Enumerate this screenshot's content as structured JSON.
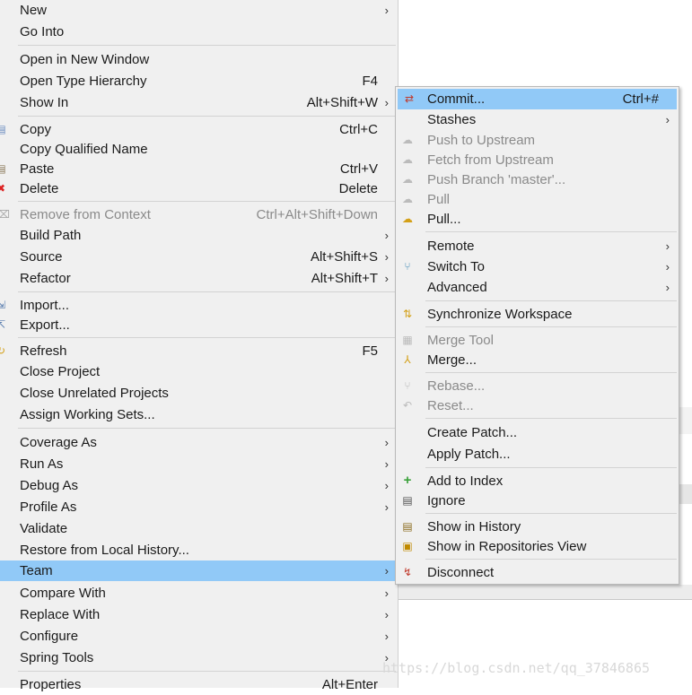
{
  "main_menu": {
    "items": [
      {
        "label": "New",
        "accel": "",
        "submenu": true
      },
      {
        "label": "Go Into",
        "accel": "",
        "submenu": false
      },
      {
        "label": "Open in New Window",
        "accel": "",
        "submenu": false
      },
      {
        "label": "Open Type Hierarchy",
        "accel": "F4",
        "submenu": false
      },
      {
        "label": "Show In",
        "accel": "Alt+Shift+W",
        "submenu": true
      },
      {
        "label": "Copy",
        "accel": "Ctrl+C",
        "submenu": false
      },
      {
        "label": "Copy Qualified Name",
        "accel": "",
        "submenu": false
      },
      {
        "label": "Paste",
        "accel": "Ctrl+V",
        "submenu": false
      },
      {
        "label": "Delete",
        "accel": "Delete",
        "submenu": false
      },
      {
        "label": "Remove from Context",
        "accel": "Ctrl+Alt+Shift+Down",
        "submenu": false,
        "disabled": true
      },
      {
        "label": "Build Path",
        "accel": "",
        "submenu": true
      },
      {
        "label": "Source",
        "accel": "Alt+Shift+S",
        "submenu": true
      },
      {
        "label": "Refactor",
        "accel": "Alt+Shift+T",
        "submenu": true
      },
      {
        "label": "Import...",
        "accel": "",
        "submenu": false
      },
      {
        "label": "Export...",
        "accel": "",
        "submenu": false
      },
      {
        "label": "Refresh",
        "accel": "F5",
        "submenu": false
      },
      {
        "label": "Close Project",
        "accel": "",
        "submenu": false
      },
      {
        "label": "Close Unrelated Projects",
        "accel": "",
        "submenu": false
      },
      {
        "label": "Assign Working Sets...",
        "accel": "",
        "submenu": false
      },
      {
        "label": "Coverage As",
        "accel": "",
        "submenu": true
      },
      {
        "label": "Run As",
        "accel": "",
        "submenu": true
      },
      {
        "label": "Debug As",
        "accel": "",
        "submenu": true
      },
      {
        "label": "Profile As",
        "accel": "",
        "submenu": true
      },
      {
        "label": "Validate",
        "accel": "",
        "submenu": false
      },
      {
        "label": "Restore from Local History...",
        "accel": "",
        "submenu": false
      },
      {
        "label": "Team",
        "accel": "",
        "submenu": true,
        "highlighted": true
      },
      {
        "label": "Compare With",
        "accel": "",
        "submenu": true
      },
      {
        "label": "Replace With",
        "accel": "",
        "submenu": true
      },
      {
        "label": "Configure",
        "accel": "",
        "submenu": true
      },
      {
        "label": "Spring Tools",
        "accel": "",
        "submenu": true
      },
      {
        "label": "Properties",
        "accel": "Alt+Enter",
        "submenu": false
      }
    ]
  },
  "team_menu": {
    "items": [
      {
        "label": "Commit...",
        "accel": "Ctrl+#",
        "submenu": false,
        "highlighted": true,
        "icon": "commit-icon"
      },
      {
        "label": "Stashes",
        "accel": "",
        "submenu": true
      },
      {
        "label": "Push to Upstream",
        "accel": "",
        "submenu": false,
        "disabled": true,
        "icon": "push-icon"
      },
      {
        "label": "Fetch from Upstream",
        "accel": "",
        "submenu": false,
        "disabled": true,
        "icon": "fetch-icon"
      },
      {
        "label": "Push Branch 'master'...",
        "accel": "",
        "submenu": false,
        "disabled": true,
        "icon": "push-branch-icon"
      },
      {
        "label": "Pull",
        "accel": "",
        "submenu": false,
        "disabled": true,
        "icon": "pull-icon"
      },
      {
        "label": "Pull...",
        "accel": "",
        "submenu": false,
        "icon": "pull-dialog-icon"
      },
      {
        "label": "Remote",
        "accel": "",
        "submenu": true
      },
      {
        "label": "Switch To",
        "accel": "",
        "submenu": true,
        "icon": "switch-branch-icon"
      },
      {
        "label": "Advanced",
        "accel": "",
        "submenu": true
      },
      {
        "label": "Synchronize Workspace",
        "accel": "",
        "submenu": false,
        "icon": "synchronize-icon"
      },
      {
        "label": "Merge Tool",
        "accel": "",
        "submenu": false,
        "disabled": true,
        "icon": "merge-tool-icon"
      },
      {
        "label": "Merge...",
        "accel": "",
        "submenu": false,
        "icon": "merge-icon"
      },
      {
        "label": "Rebase...",
        "accel": "",
        "submenu": false,
        "disabled": true,
        "icon": "rebase-icon"
      },
      {
        "label": "Reset...",
        "accel": "",
        "submenu": false,
        "disabled": true,
        "icon": "reset-icon"
      },
      {
        "label": "Create Patch...",
        "accel": "",
        "submenu": false
      },
      {
        "label": "Apply Patch...",
        "accel": "",
        "submenu": false
      },
      {
        "label": "Add to Index",
        "accel": "",
        "submenu": false,
        "icon": "add-icon"
      },
      {
        "label": "Ignore",
        "accel": "",
        "submenu": false,
        "icon": "ignore-icon"
      },
      {
        "label": "Show in History",
        "accel": "",
        "submenu": false,
        "icon": "history-icon"
      },
      {
        "label": "Show in Repositories View",
        "accel": "",
        "submenu": false,
        "icon": "repositories-icon"
      },
      {
        "label": "Disconnect",
        "accel": "",
        "submenu": false,
        "icon": "disconnect-icon"
      }
    ]
  },
  "submenu_arrow": "›",
  "watermark": "https://blog.csdn.net/qq_37846865",
  "colors": {
    "highlight": "#91c9f7",
    "menu_bg": "#f0f0f0",
    "disabled": "#8a8a8a"
  }
}
